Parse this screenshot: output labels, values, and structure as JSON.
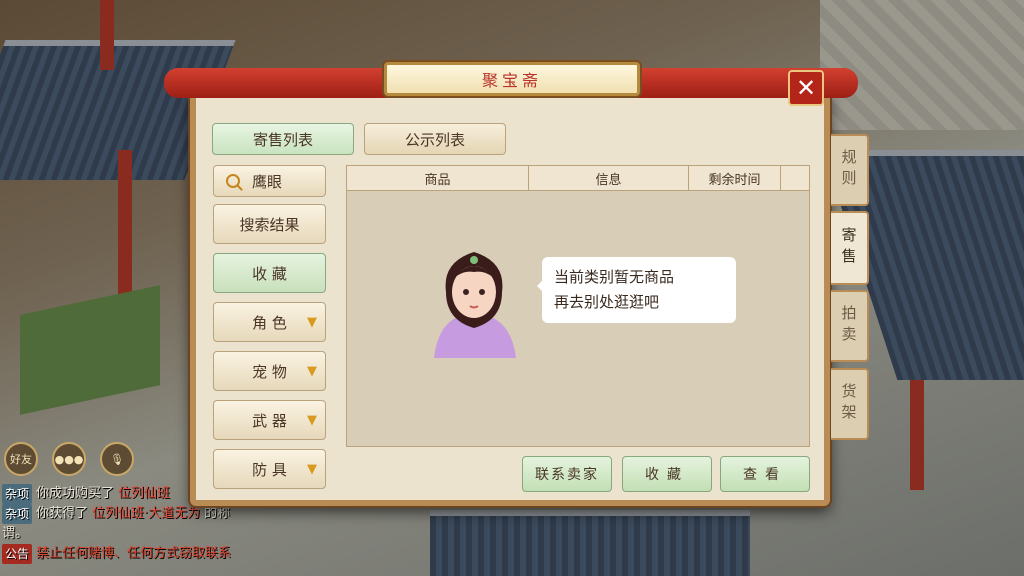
{
  "window": {
    "title": "聚宝斋",
    "close_label": "✕"
  },
  "top_tabs": [
    {
      "label": "寄售列表",
      "active": true
    },
    {
      "label": "公示列表",
      "active": false
    }
  ],
  "sidebar": {
    "search_label": "鹰眼",
    "items": [
      {
        "label": "搜索结果",
        "has_arrow": false,
        "active": false
      },
      {
        "label": "收 藏",
        "has_arrow": false,
        "active": true
      },
      {
        "label": "角 色",
        "has_arrow": true,
        "active": false
      },
      {
        "label": "宠 物",
        "has_arrow": true,
        "active": false
      },
      {
        "label": "武 器",
        "has_arrow": true,
        "active": false
      },
      {
        "label": "防 具",
        "has_arrow": true,
        "active": false
      }
    ]
  },
  "table": {
    "columns": [
      "商品",
      "信息",
      "剩余时间",
      ""
    ]
  },
  "empty_message": {
    "line1": "当前类别暂无商品",
    "line2": "再去别处逛逛吧"
  },
  "actions": {
    "contact_seller": "联系卖家",
    "favorite": "收藏",
    "view": "查看"
  },
  "side_tabs": [
    {
      "label": "规则",
      "active": false
    },
    {
      "label": "寄售",
      "active": true
    },
    {
      "label": "拍卖",
      "active": false
    },
    {
      "label": "货架",
      "active": false
    }
  ],
  "chat": {
    "icons": {
      "friends": "好友",
      "chat": "chat-bubble-icon",
      "voice": "microphone-icon"
    },
    "lines": [
      {
        "tag": "杂项",
        "text": "你成功购买了",
        "highlight": "位列仙班"
      },
      {
        "tag": "杂项",
        "text": "你获得了",
        "highlight": "位列仙班·大道无为",
        "tail": "的称"
      },
      {
        "tag": "",
        "text": "谓。",
        "highlight": ""
      },
      {
        "tag": "公告",
        "text": "",
        "highlight": "禁止任何赌博、任何方式窃取联系"
      }
    ]
  },
  "colors": {
    "accent_red": "#b32419",
    "panel_bg": "#ece3cf",
    "active_green": "#c8e0bc",
    "frame": "#b98b55"
  }
}
